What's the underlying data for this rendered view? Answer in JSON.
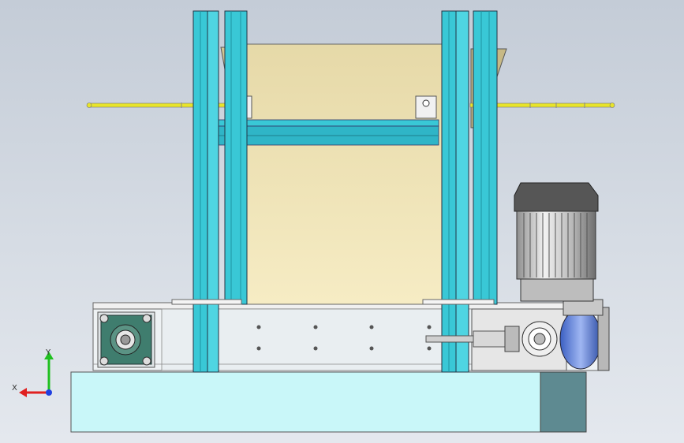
{
  "viewport": {
    "background_top": "#c4ccd7",
    "background_bottom": "#e4e8ee"
  },
  "model": {
    "base_color": "#c9f7f9",
    "base_side_color": "#5e8a91",
    "frame_color": "#39c8d6",
    "hopper_color": "#efe3b4",
    "shaft_color": "#e8e42a",
    "motor_color": "#cfcfcf",
    "gearbox_color": "#6d8fe0",
    "bearing_color": "#3f7d6e"
  },
  "triad": {
    "x_label": "X",
    "y_label": "Y",
    "x_color": "#e02020",
    "y_color": "#20c020",
    "z_color": "#2040e0"
  }
}
